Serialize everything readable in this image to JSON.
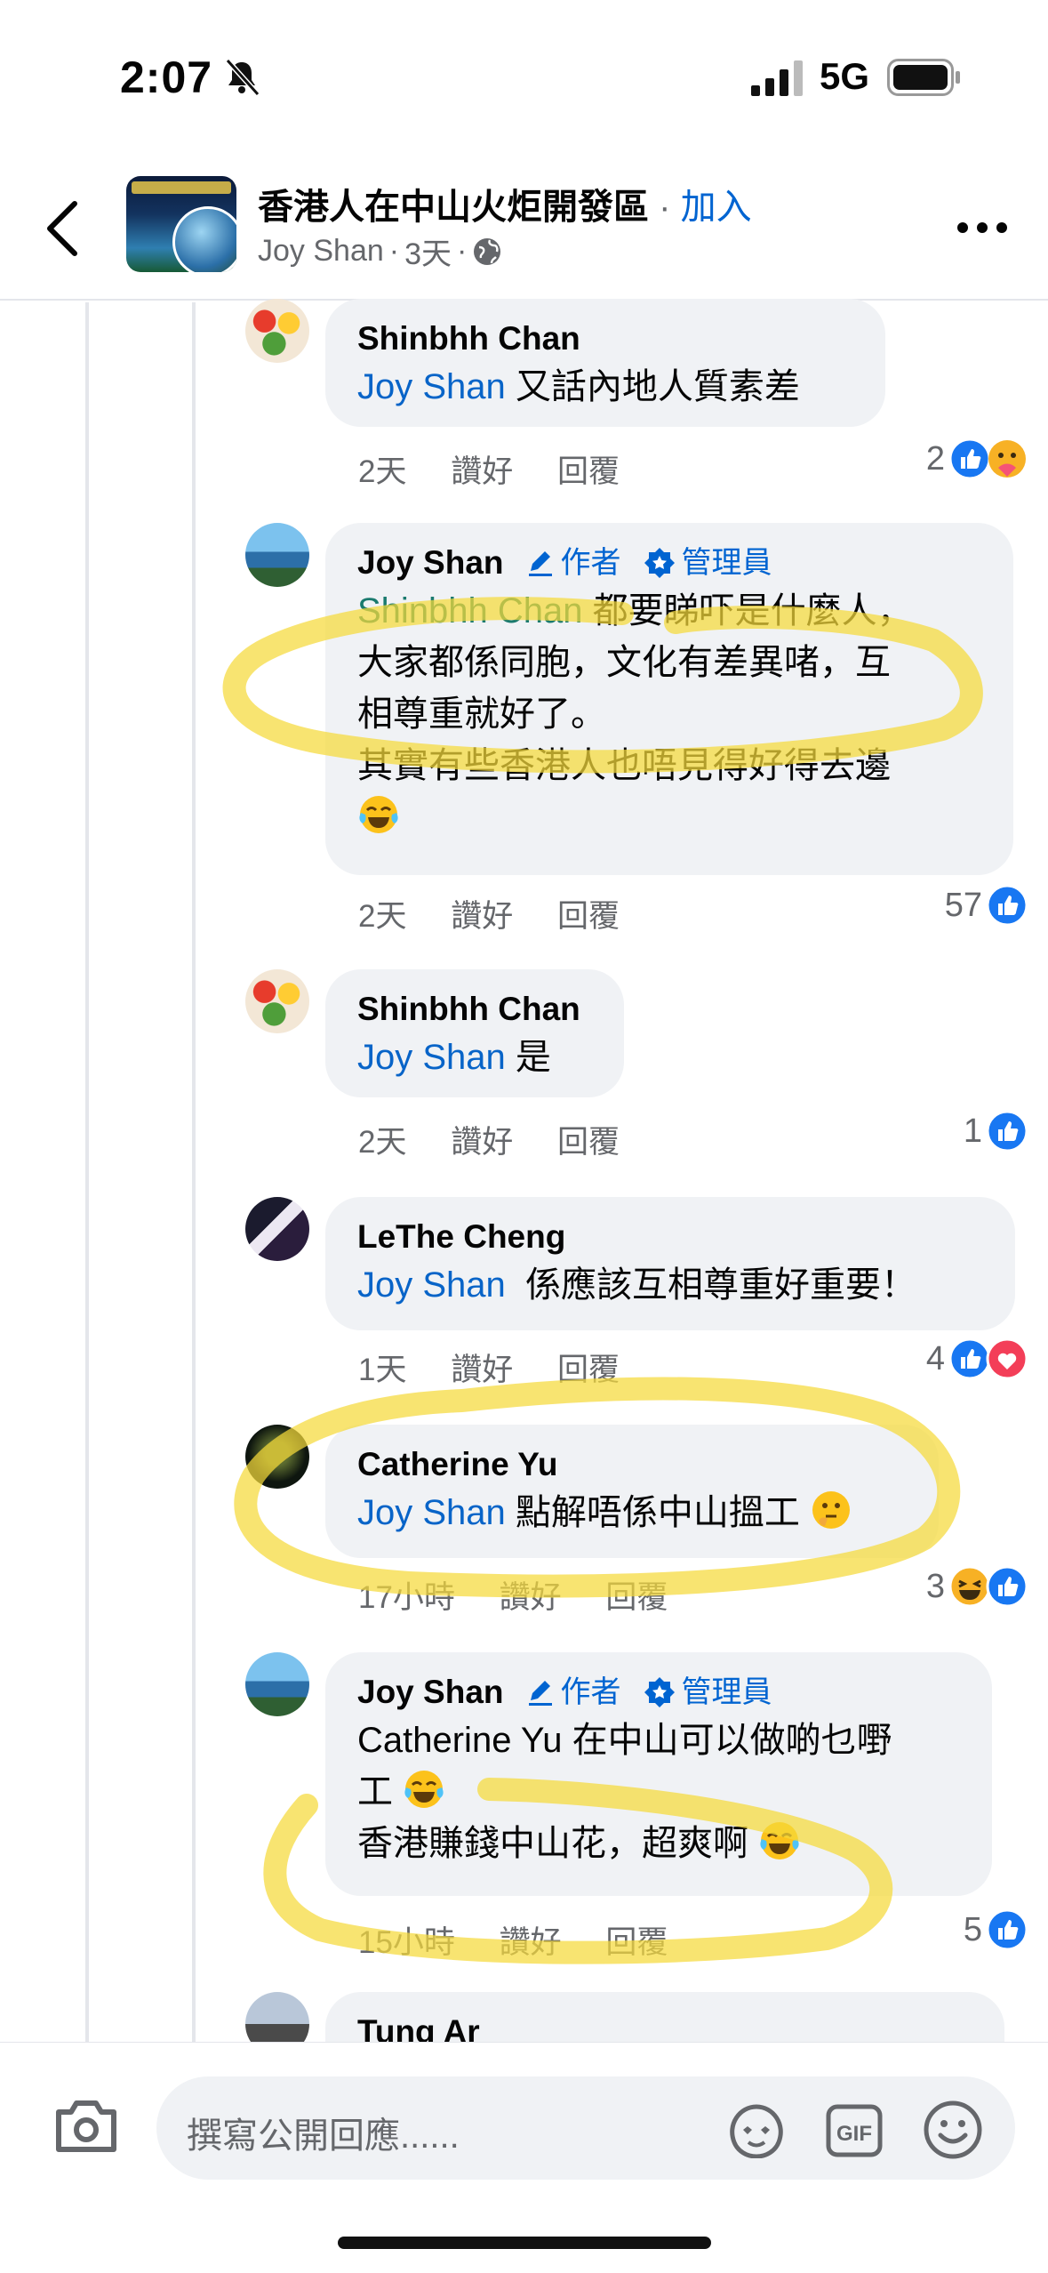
{
  "status_bar": {
    "time": "2:07",
    "network": "5G"
  },
  "header": {
    "group_name": "香港人在中山火炬開發區",
    "separator": "·",
    "join_label": "加入",
    "author": "Joy Shan",
    "age": "3天",
    "dot": "·"
  },
  "labels": {
    "like": "讚好",
    "reply": "回覆",
    "author_badge": "作者",
    "admin_badge": "管理員"
  },
  "comments": [
    {
      "name": "Shinbhh Chan",
      "mention": "Joy Shan",
      "text": " 又話內地人質素差",
      "time": "2天",
      "reaction_count": "2"
    },
    {
      "name": "Joy Shan",
      "mention": "Shinbhh Chan",
      "line1": " 都要睇吓是什麼人，",
      "line2": "大家都係同胞，文化有差異啫，互",
      "line3": "相尊重就好了。",
      "line4": "其實有些香港人也唔見得好得去邊",
      "time": "2天",
      "reaction_count": "57"
    },
    {
      "name": "Shinbhh Chan",
      "mention": "Joy Shan",
      "text": " 是",
      "time": "2天",
      "reaction_count": "1"
    },
    {
      "name": "LeThe Cheng",
      "mention": "Joy Shan",
      "text": "  係應該互相尊重好重要！",
      "time": "1天",
      "reaction_count": "4"
    },
    {
      "name": "Catherine Yu",
      "mention": "Joy Shan",
      "text": " 點解唔係中山搵工",
      "time": "17小時",
      "reaction_count": "3"
    },
    {
      "name": "Joy Shan",
      "line1": "Catherine Yu 在中山可以做啲乜嘢",
      "line2": "工",
      "line3": "香港賺錢中山花，超爽啊",
      "time": "15小時",
      "reaction_count": "5"
    },
    {
      "name": "Tung Ar"
    }
  ],
  "composer": {
    "placeholder": "撰寫公開回應......"
  },
  "colors": {
    "link": "#0064d1",
    "bubble": "#f0f2f5",
    "like_blue": "#1877f2",
    "highlight": "#f5d93a"
  }
}
